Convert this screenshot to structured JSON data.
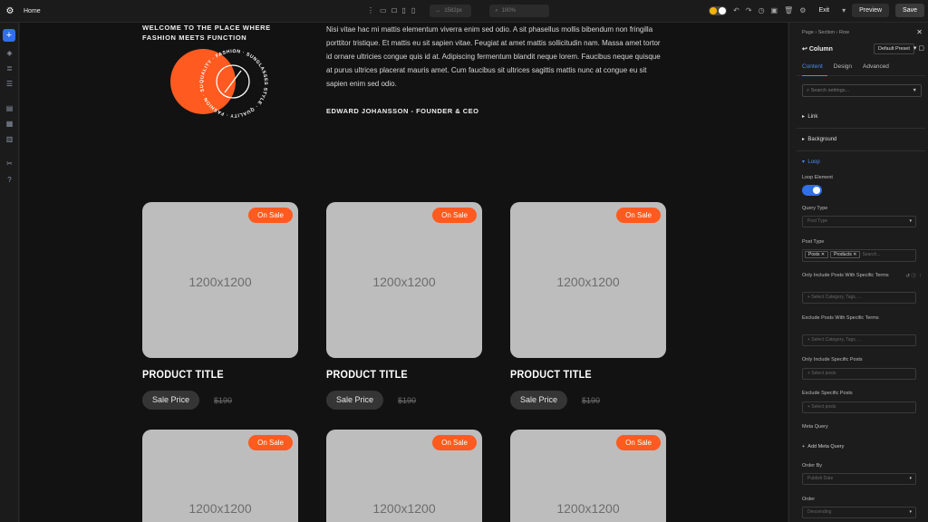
{
  "topbar": {
    "home": "Home",
    "width_value": "1582px",
    "zoom_value": "100%",
    "exit": "Exit",
    "preview": "Preview",
    "save": "Save"
  },
  "canvas": {
    "headline": "WELCOME TO THE PLACE WHERE FASHION MEETS FUNCTION",
    "badge_ring_text": "QUALITY · FASHION · SUNGLASSES STYLE · QUALITY · FASHION · SUNGLASSES STYLE ·",
    "quote": "Nisi vitae hac mi mattis elementum viverra enim sed odio. A sit phasellus mollis bibendum non fringilla porttitor tristique. Et mattis eu sit sapien vitae. Feugiat at amet mattis sollicitudin nam. Massa amet tortor id ornare ultricies congue quis id at. Adipiscing fermentum blandit neque lorem. Faucibus neque quisque at purus ultrices placerat mauris amet. Cum faucibus sit ultrices sagittis mattis nunc at congue eu sit sapien enim sed odio.",
    "author": "EDWARD JOHANSSON - FOUNDER & CEO",
    "products": [
      {
        "placeholder": "1200x1200",
        "badge": "On Sale",
        "title": "PRODUCT TITLE",
        "sale_price": "Sale Price",
        "old_price": "$190"
      },
      {
        "placeholder": "1200x1200",
        "badge": "On Sale",
        "title": "PRODUCT TITLE",
        "sale_price": "Sale Price",
        "old_price": "$190"
      },
      {
        "placeholder": "1200x1200",
        "badge": "On Sale",
        "title": "PRODUCT TITLE",
        "sale_price": "Sale Price",
        "old_price": "$190"
      },
      {
        "placeholder": "1200x1200",
        "badge": "On Sale"
      },
      {
        "placeholder": "1200x1200",
        "badge": "On Sale"
      },
      {
        "placeholder": "1200x1200",
        "badge": "On Sale"
      }
    ]
  },
  "panel": {
    "breadcrumb": "Page › Section › Row",
    "title": "Column",
    "preset": "Default Preset",
    "tabs": [
      "Content",
      "Design",
      "Advanced"
    ],
    "search_placeholder": "Search settings...",
    "sections": [
      "Link",
      "Background",
      "Loop"
    ],
    "loop_element": "Loop Element",
    "query_type_label": "Query Type",
    "query_type_value": "Post Type",
    "post_type_label": "Post Type",
    "post_type_chips": [
      "Posts",
      "Products"
    ],
    "post_type_search": "Search...",
    "only_terms_label": "Only Include Posts With Specific Terms",
    "only_terms_placeholder": "+ Select Category, Tags, ...",
    "exclude_terms_label": "Exclude Posts With Specific Terms",
    "exclude_terms_placeholder": "+ Select Category, Tags, ...",
    "only_posts_label": "Only Include Specific Posts",
    "only_posts_placeholder": "+ Select posts",
    "exclude_posts_label": "Exclude Specific Posts",
    "exclude_posts_placeholder": "+ Select posts",
    "meta_query_label": "Meta Query",
    "add_meta_query": "Add Meta Query",
    "order_by_label": "Order By",
    "order_by_value": "Publish Date",
    "order_label": "Order",
    "order_value": "Descending"
  },
  "colors": {
    "accent": "#2f6fe8",
    "sale": "#ff5a1f"
  }
}
